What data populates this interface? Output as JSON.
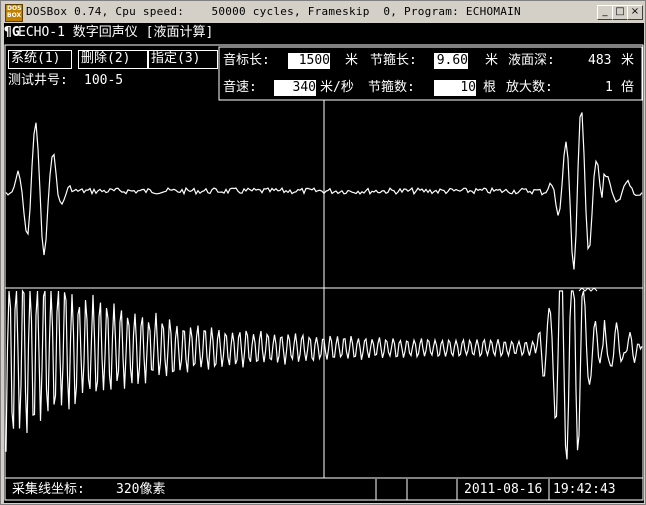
{
  "window": {
    "icon_text": "DOS BOX",
    "title": "DOSBox 0.74, Cpu speed:    50000 cycles, Frameskip  0, Program: ECHOMAIN",
    "buttons": [
      "_",
      "□",
      "×"
    ]
  },
  "app": {
    "logo": "¶G",
    "title": "ECHO-1 数字回声仪 [液面计算]"
  },
  "menu": [
    {
      "label": "系统(1)"
    },
    {
      "label": "删除(2)"
    },
    {
      "label": "指定(3)"
    }
  ],
  "well": {
    "label": "测试井号:",
    "value": "100-5"
  },
  "params": {
    "marker_length_label": "音标长:",
    "marker_length_value": "1500",
    "marker_length_unit": "米",
    "joint_length_label": "节箍长:",
    "joint_length_value": "9.60",
    "joint_length_unit": "米",
    "level_depth_label": "液面深:",
    "level_depth_value": "483",
    "level_depth_unit": "米",
    "sound_speed_label": "音速:",
    "sound_speed_value": "340",
    "sound_speed_unit": "米/秒",
    "joint_count_label": "节箍数:",
    "joint_count_value": "10",
    "joint_count_unit": "根",
    "gain_label": "放大数:",
    "gain_value": "1",
    "gain_unit": "倍"
  },
  "status": {
    "cursor_label": "采集线坐标:",
    "cursor_value": "320像素",
    "date": "2011-08-16",
    "time": "19:42:43"
  }
}
